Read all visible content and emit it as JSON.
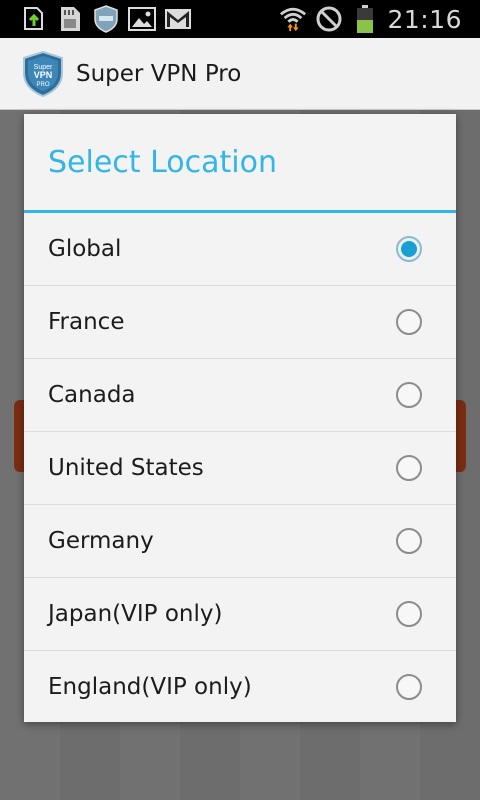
{
  "status_bar": {
    "left_icons": [
      "download-icon",
      "sd-card-icon",
      "vpn-shield-icon",
      "gallery-icon",
      "gmail-icon"
    ],
    "right_icons": [
      "wifi-icon",
      "do-not-disturb-icon",
      "battery-icon"
    ],
    "time": "21:16"
  },
  "app": {
    "title": "Super VPN Pro",
    "logo_text": [
      "Super",
      "VPN",
      "PRO"
    ]
  },
  "dialog": {
    "title": "Select Location",
    "accent_color": "#33b5e5",
    "options": [
      {
        "label": "Global",
        "selected": true
      },
      {
        "label": "France",
        "selected": false
      },
      {
        "label": "Canada",
        "selected": false
      },
      {
        "label": "United States",
        "selected": false
      },
      {
        "label": "Germany",
        "selected": false
      },
      {
        "label": "Japan(VIP only)",
        "selected": false
      },
      {
        "label": "England(VIP only)",
        "selected": false
      }
    ]
  }
}
